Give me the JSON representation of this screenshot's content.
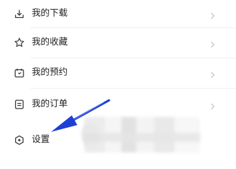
{
  "menu": {
    "items": [
      {
        "label": "我的下载",
        "icon": "download-icon"
      },
      {
        "label": "我的收藏",
        "icon": "star-icon"
      },
      {
        "label": "我的预约",
        "icon": "calendar-icon"
      },
      {
        "label": "我的订单",
        "icon": "order-icon"
      },
      {
        "label": "设置",
        "icon": "settings-icon"
      }
    ]
  },
  "colors": {
    "text": "#222222",
    "icon": "#333333",
    "chevron": "#bdbdbd",
    "divider": "#efefef",
    "annotation_arrow": "#1e3fd6"
  }
}
